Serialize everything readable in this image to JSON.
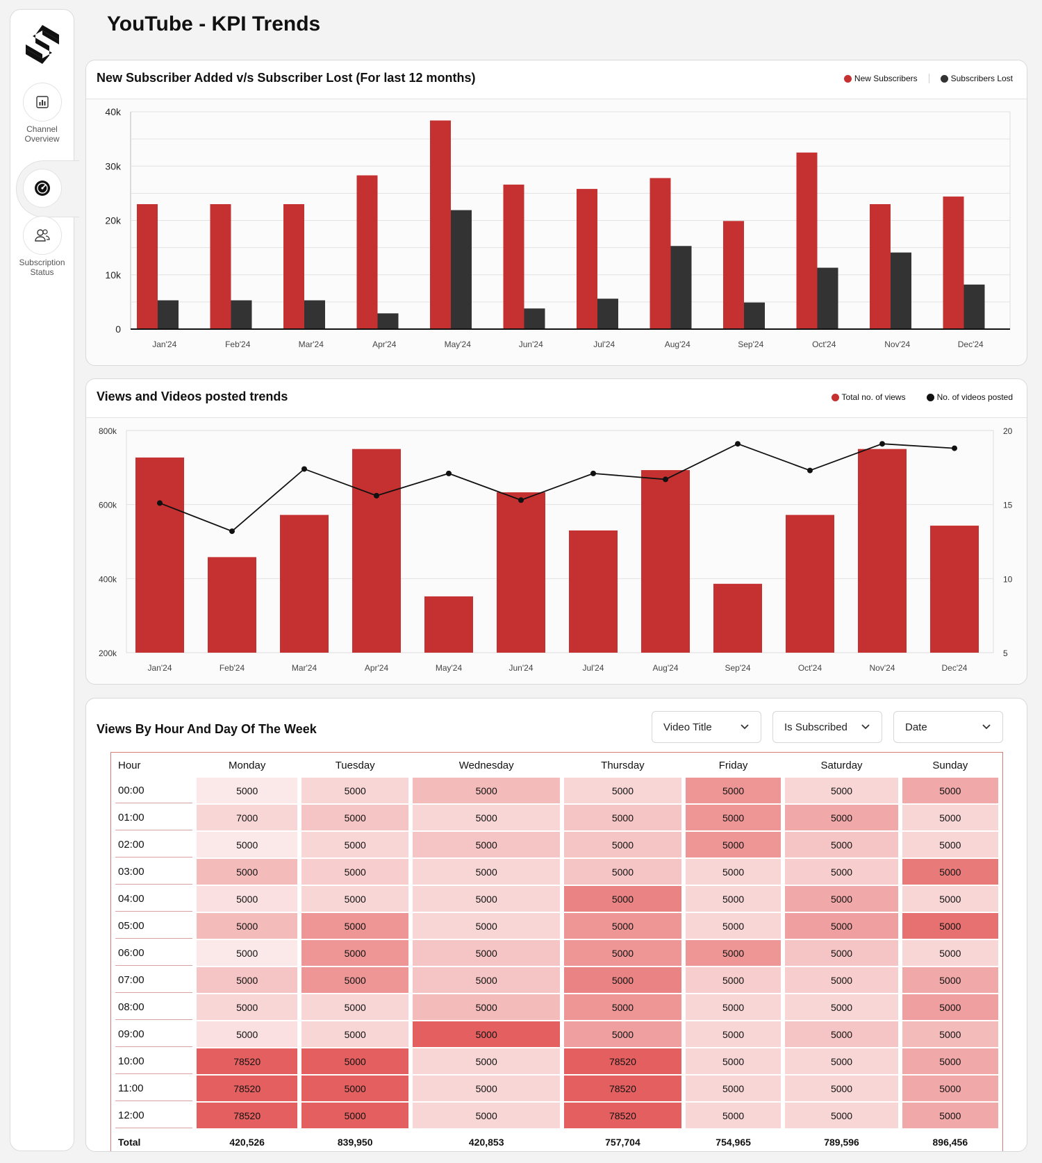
{
  "page_title": "YouTube - KPI Trends",
  "sidebar": {
    "items": [
      {
        "label_line1": "Channel",
        "label_line2": "Overview",
        "icon": "chart-icon"
      },
      {
        "label_line1": "",
        "label_line2": "",
        "icon": "gauge-icon",
        "active": true
      },
      {
        "label_line1": "Subscription",
        "label_line2": "Status",
        "icon": "users-icon"
      }
    ]
  },
  "subscriber_card": {
    "title": "New Subscriber Added v/s Subscriber Lost (For last 12 months)",
    "legend": [
      {
        "name": "New Subscribers",
        "color": "#c53030"
      },
      {
        "name": "Subscribers Lost",
        "color": "#333333"
      }
    ]
  },
  "views_card": {
    "title": "Views and Videos posted trends",
    "legend": [
      {
        "name": "Total no. of views",
        "color": "#c53030"
      },
      {
        "name": "No. of videos posted",
        "color": "#111111"
      }
    ]
  },
  "heatmap_card": {
    "title": "Views By Hour And Day Of The Week",
    "filters": [
      "Video Title",
      "Is Subscribed",
      "Date"
    ],
    "hour_header": "Hour",
    "days": [
      "Monday",
      "Tuesday",
      "Wednesday",
      "Thursday",
      "Friday",
      "Saturday",
      "Sunday"
    ],
    "rows": [
      {
        "hour": "00:00",
        "values": [
          "5000",
          "5000",
          "5000",
          "5000",
          "5000",
          "5000",
          "5000"
        ],
        "levels": [
          0.05,
          0.15,
          0.3,
          0.15,
          0.5,
          0.15,
          0.4
        ]
      },
      {
        "hour": "01:00",
        "values": [
          "7000",
          "5000",
          "5000",
          "5000",
          "5000",
          "5000",
          "5000"
        ],
        "levels": [
          0.15,
          0.25,
          0.15,
          0.25,
          0.5,
          0.4,
          0.15
        ]
      },
      {
        "hour": "02:00",
        "values": [
          "5000",
          "5000",
          "5000",
          "5000",
          "5000",
          "5000",
          "5000"
        ],
        "levels": [
          0.05,
          0.15,
          0.25,
          0.25,
          0.5,
          0.25,
          0.15
        ]
      },
      {
        "hour": "03:00",
        "values": [
          "5000",
          "5000",
          "5000",
          "5000",
          "5000",
          "5000",
          "5000"
        ],
        "levels": [
          0.3,
          0.2,
          0.15,
          0.25,
          0.15,
          0.2,
          0.65
        ]
      },
      {
        "hour": "04:00",
        "values": [
          "5000",
          "5000",
          "5000",
          "5000",
          "5000",
          "5000",
          "5000"
        ],
        "levels": [
          0.1,
          0.15,
          0.15,
          0.6,
          0.15,
          0.4,
          0.15
        ]
      },
      {
        "hour": "05:00",
        "values": [
          "5000",
          "5000",
          "5000",
          "5000",
          "5000",
          "5000",
          "5000"
        ],
        "levels": [
          0.3,
          0.5,
          0.15,
          0.5,
          0.15,
          0.45,
          0.7
        ]
      },
      {
        "hour": "06:00",
        "values": [
          "5000",
          "5000",
          "5000",
          "5000",
          "5000",
          "5000",
          "5000"
        ],
        "levels": [
          0.05,
          0.5,
          0.25,
          0.5,
          0.5,
          0.25,
          0.15
        ]
      },
      {
        "hour": "07:00",
        "values": [
          "5000",
          "5000",
          "5000",
          "5000",
          "5000",
          "5000",
          "5000"
        ],
        "levels": [
          0.25,
          0.5,
          0.25,
          0.6,
          0.2,
          0.2,
          0.4
        ]
      },
      {
        "hour": "08:00",
        "values": [
          "5000",
          "5000",
          "5000",
          "5000",
          "5000",
          "5000",
          "5000"
        ],
        "levels": [
          0.15,
          0.15,
          0.3,
          0.5,
          0.15,
          0.15,
          0.45
        ]
      },
      {
        "hour": "09:00",
        "values": [
          "5000",
          "5000",
          "5000",
          "5000",
          "5000",
          "5000",
          "5000"
        ],
        "levels": [
          0.1,
          0.15,
          0.8,
          0.45,
          0.15,
          0.25,
          0.3
        ]
      },
      {
        "hour": "10:00",
        "values": [
          "78520",
          "5000",
          "5000",
          "78520",
          "5000",
          "5000",
          "5000"
        ],
        "levels": [
          0.8,
          0.8,
          0.15,
          0.8,
          0.15,
          0.15,
          0.4
        ]
      },
      {
        "hour": "11:00",
        "values": [
          "78520",
          "5000",
          "5000",
          "78520",
          "5000",
          "5000",
          "5000"
        ],
        "levels": [
          0.8,
          0.8,
          0.15,
          0.8,
          0.15,
          0.15,
          0.4
        ]
      },
      {
        "hour": "12:00",
        "values": [
          "78520",
          "5000",
          "5000",
          "78520",
          "5000",
          "5000",
          "5000"
        ],
        "levels": [
          0.8,
          0.8,
          0.15,
          0.8,
          0.15,
          0.15,
          0.4
        ]
      }
    ],
    "total_label": "Total",
    "totals": [
      "420,526",
      "839,950",
      "420,853",
      "757,704",
      "754,965",
      "789,596",
      "896,456"
    ]
  },
  "chart_data": [
    {
      "type": "bar",
      "title": "New Subscriber Added v/s Subscriber Lost (For last 12 months)",
      "categories": [
        "Jan'24",
        "Feb'24",
        "Mar'24",
        "Apr'24",
        "May'24",
        "Jun'24",
        "Jul'24",
        "Aug'24",
        "Sep'24",
        "Oct'24",
        "Nov'24",
        "Dec'24"
      ],
      "series": [
        {
          "name": "New Subscribers",
          "color": "#c53030",
          "values": [
            23000,
            23000,
            23000,
            28300,
            38400,
            26600,
            25800,
            27800,
            19900,
            32500,
            23000,
            24400
          ]
        },
        {
          "name": "Subscribers Lost",
          "color": "#333333",
          "values": [
            5300,
            5300,
            5300,
            2900,
            21900,
            3800,
            5600,
            15300,
            4900,
            11300,
            14100,
            8200
          ]
        }
      ],
      "ylim": [
        0,
        40000
      ],
      "yticks": [
        {
          "value": 0,
          "label": "0"
        },
        {
          "value": 10000,
          "label": "10k"
        },
        {
          "value": 20000,
          "label": "20k"
        },
        {
          "value": 30000,
          "label": "30k"
        },
        {
          "value": 40000,
          "label": "40k"
        }
      ],
      "grid": true,
      "legend": "top-right"
    },
    {
      "type": "bar",
      "title": "Views and Videos posted trends",
      "categories": [
        "Jan'24",
        "Feb'24",
        "Mar'24",
        "Apr'24",
        "May'24",
        "Jun'24",
        "Jul'24",
        "Aug'24",
        "Sep'24",
        "Oct'24",
        "Nov'24",
        "Dec'24"
      ],
      "series": [
        {
          "name": "Total no. of views",
          "type": "bar",
          "axis": "left",
          "color": "#c53030",
          "values": [
            727000,
            458000,
            572000,
            750000,
            352000,
            633000,
            530000,
            693000,
            386000,
            572000,
            750000,
            543000
          ]
        },
        {
          "name": "No. of videos posted",
          "type": "line",
          "axis": "right",
          "color": "#111111",
          "values": [
            15.1,
            13.2,
            17.4,
            15.6,
            17.1,
            15.3,
            17.1,
            16.7,
            19.1,
            17.3,
            19.1,
            18.8
          ]
        }
      ],
      "ylim_left": [
        200000,
        800000
      ],
      "yticks_left": [
        {
          "value": 200000,
          "label": "200k"
        },
        {
          "value": 400000,
          "label": "400k"
        },
        {
          "value": 600000,
          "label": "600k"
        },
        {
          "value": 800000,
          "label": "800k"
        }
      ],
      "ylim_right": [
        5,
        20
      ],
      "yticks_right": [
        5,
        10,
        15,
        20
      ],
      "grid": true,
      "legend": "top-right"
    }
  ]
}
